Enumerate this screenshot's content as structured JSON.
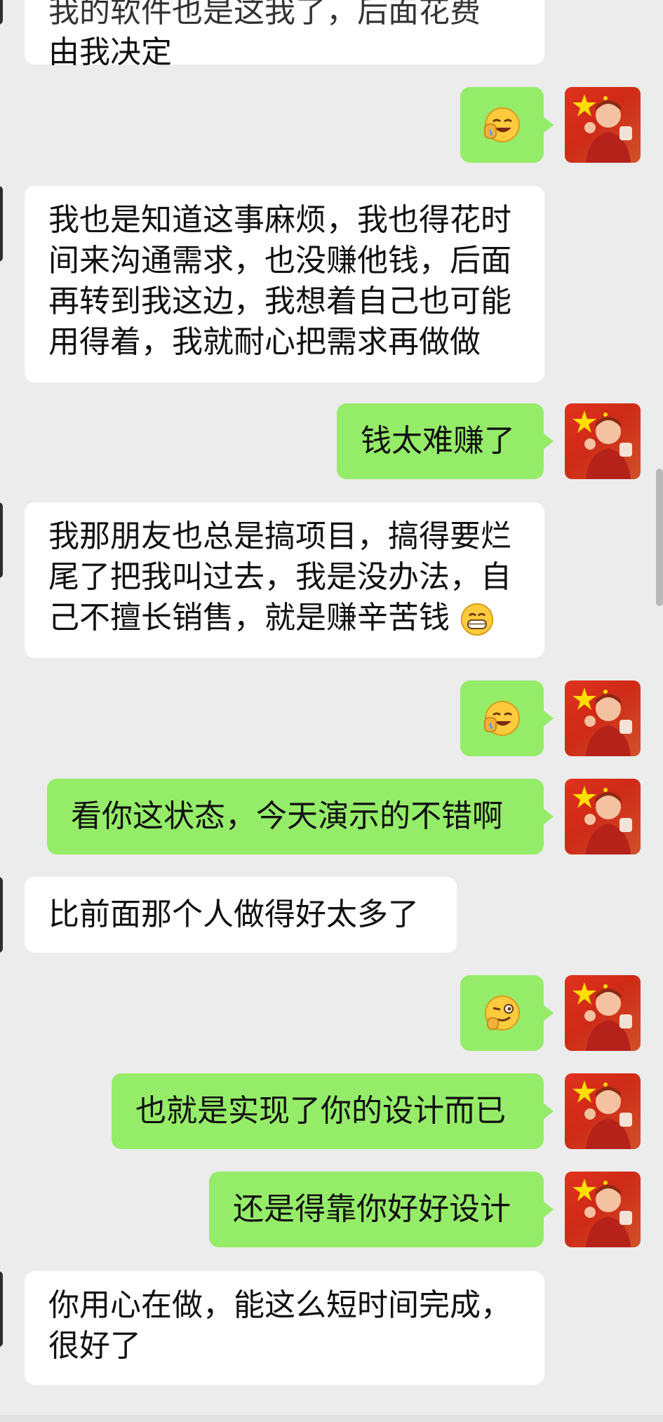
{
  "messages": [
    {
      "side": "in",
      "text_lines": [
        "我的软件也是这我了，后面花费",
        "由我决定"
      ]
    },
    {
      "side": "out",
      "emoji": "facepalm-laugh-emoji"
    },
    {
      "side": "in",
      "text_lines": [
        "我也是知道这事麻烦，我也得花时",
        "间来沟通需求，也没赚他钱，后面",
        "再转到我这边，我想着自己也可能",
        "用得着，我就耐心把需求再做做"
      ]
    },
    {
      "side": "out",
      "text": "钱太难赚了"
    },
    {
      "side": "in",
      "text_lines": [
        "我那朋友也总是搞项目，搞得要烂",
        "尾了把我叫过去，我是没办法，自",
        "己不擅长销售，就是赚辛苦钱"
      ],
      "trailing_emoji": "grin-emoji"
    },
    {
      "side": "out",
      "emoji": "facepalm-laugh-emoji"
    },
    {
      "side": "out",
      "text": "看你这状态，今天演示的不错啊"
    },
    {
      "side": "in",
      "text": "比前面那个人做得好太多了"
    },
    {
      "side": "out",
      "emoji": "thinking-smirk-emoji"
    },
    {
      "side": "out",
      "text": "也就是实现了你的设计而已"
    },
    {
      "side": "out",
      "text": "还是得靠你好好设计"
    },
    {
      "side": "in",
      "text_lines": [
        "你用心在做，能这么短时间完成，",
        "很好了"
      ]
    }
  ],
  "colors": {
    "background": "#ececec",
    "incoming_bubble": "#ffffff",
    "outgoing_bubble": "#95ec69",
    "avatar_red": "#d8301c",
    "star_yellow": "#ffde00"
  }
}
